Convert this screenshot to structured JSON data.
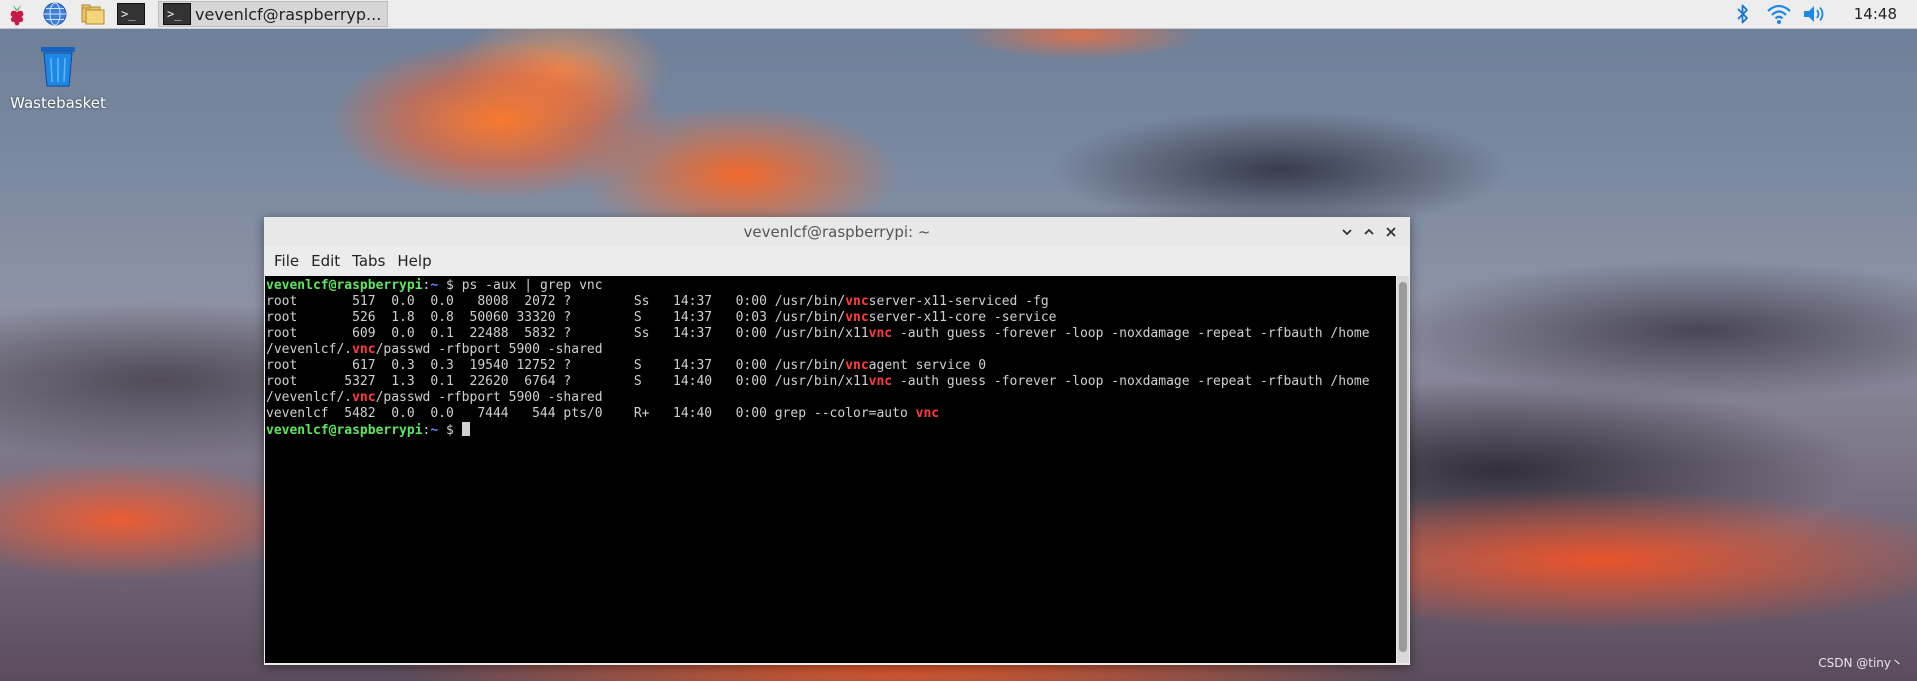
{
  "desktop": {
    "wastebasket_label": "Wastebasket",
    "watermark": "CSDN @tiny丶"
  },
  "taskbar": {
    "launchers": [
      {
        "icon": "raspberry-menu-icon"
      },
      {
        "icon": "web-browser-icon"
      },
      {
        "icon": "file-manager-icon"
      },
      {
        "icon": "terminal-icon"
      }
    ],
    "active_task": {
      "icon": "terminal-icon",
      "label": "vevenlcf@raspberryp..."
    },
    "tray": {
      "bluetooth": "bluetooth-icon",
      "wifi": "wifi-icon",
      "volume": "volume-icon",
      "clock": "14:48"
    },
    "term_glyph": ">_"
  },
  "window": {
    "title": "vevenlcf@raspberrypi: ~",
    "menu": [
      "File",
      "Edit",
      "Tabs",
      "Help"
    ],
    "controls": [
      "minimize",
      "maximize",
      "close"
    ]
  },
  "terminal": {
    "prompt_user": "vevenlcf@raspberrypi",
    "prompt_sep": ":",
    "prompt_path": "~",
    "prompt_symbol": " $ ",
    "command": "ps -aux | grep vnc",
    "output": [
      [
        "root       517  0.0  0.0   8008  2072 ?        Ss   14:37   0:00 /usr/bin/",
        "vnc",
        "server-x11-serviced -fg"
      ],
      [
        "root       526  1.8  0.8  50060 33320 ?        S    14:37   0:03 /usr/bin/",
        "vnc",
        "server-x11-core -service"
      ],
      [
        "root       609  0.0  0.1  22488  5832 ?        Ss   14:37   0:00 /usr/bin/x11",
        "vnc",
        " -auth guess -forever -loop -noxdamage -repeat -rfbauth /home"
      ],
      [
        "/vevenlcf/.",
        "vnc",
        "/passwd -rfbport 5900 -shared"
      ],
      [
        "root       617  0.3  0.3  19540 12752 ?        S    14:37   0:00 /usr/bin/",
        "vnc",
        "agent service 0"
      ],
      [
        "root      5327  1.3  0.1  22620  6764 ?        S    14:40   0:00 /usr/bin/x11",
        "vnc",
        " -auth guess -forever -loop -noxdamage -repeat -rfbauth /home"
      ],
      [
        "/vevenlcf/.",
        "vnc",
        "/passwd -rfbport 5900 -shared"
      ],
      [
        "vevenlcf  5482  0.0  0.0   7444   544 pts/0    R+   14:40   0:00 grep --color=auto ",
        "vnc",
        ""
      ]
    ]
  },
  "colors": {
    "prompt_user": "#5ee65e",
    "prompt_path": "#5b8bff",
    "match_highlight": "#ff3b3b",
    "terminal_bg": "#000000"
  }
}
